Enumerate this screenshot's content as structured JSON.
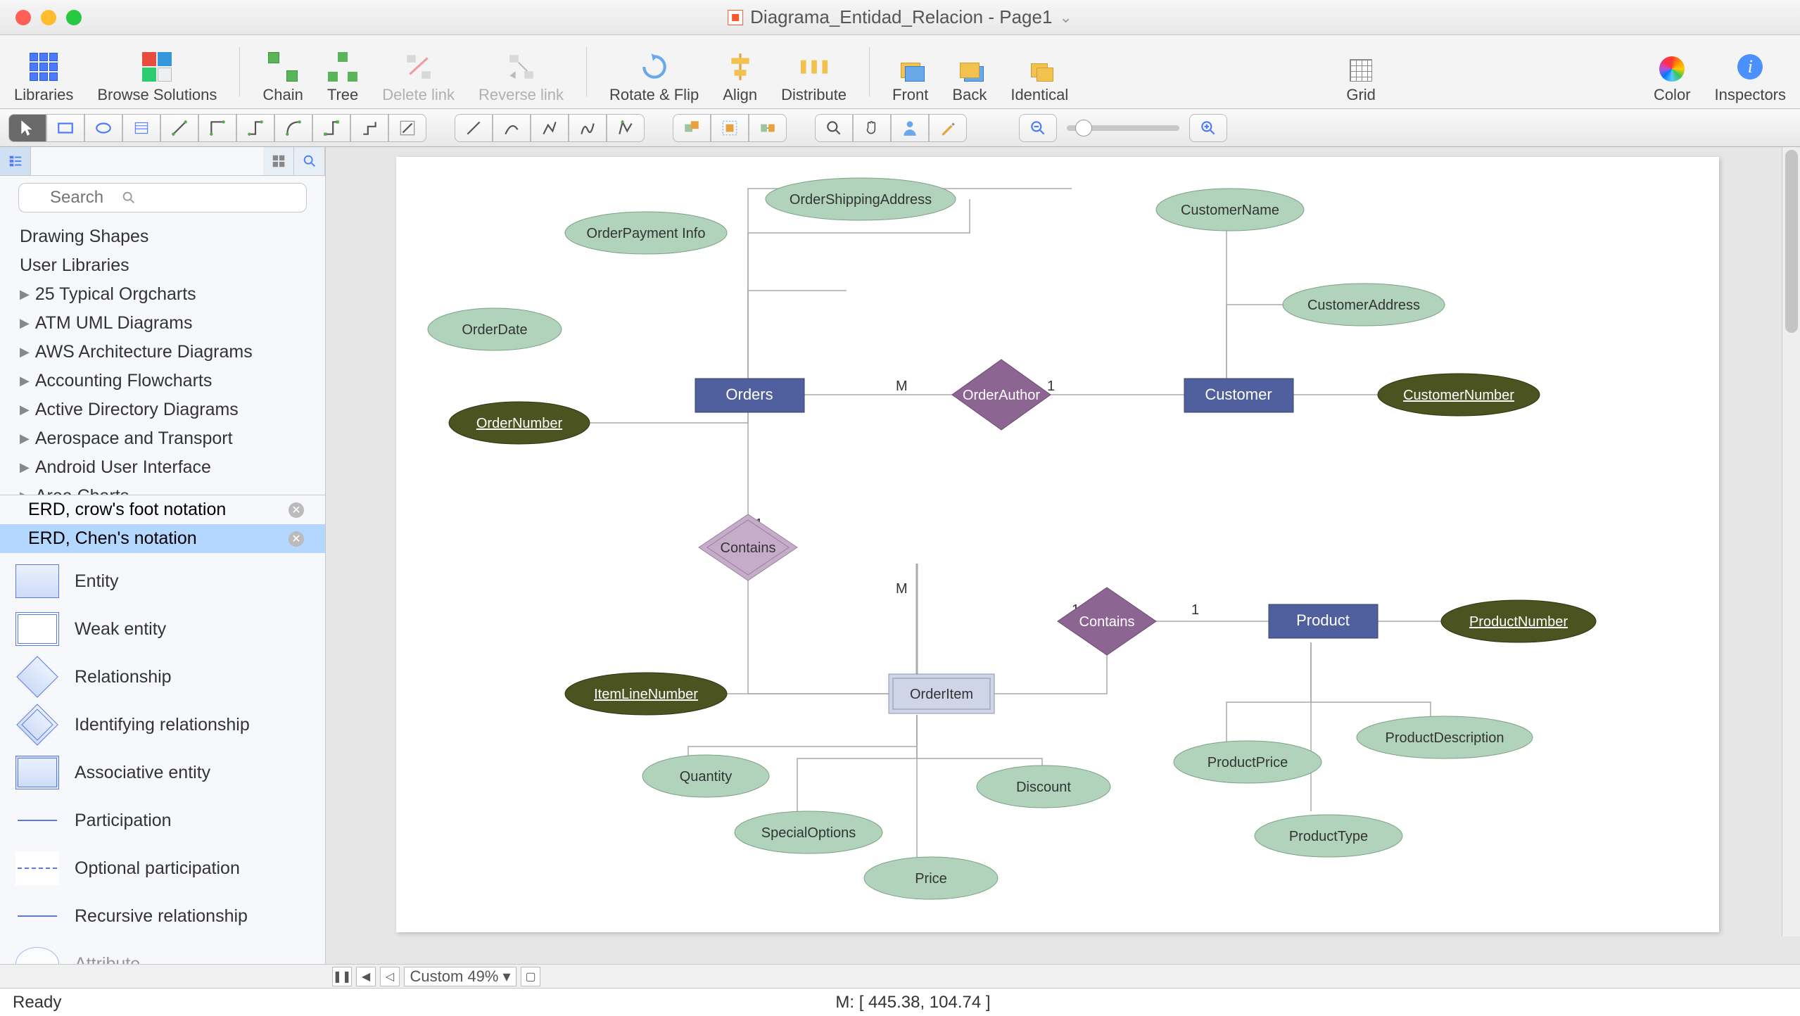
{
  "title": "Diagrama_Entidad_Relacion - Page1",
  "toolbar": {
    "libraries": "Libraries",
    "browse": "Browse Solutions",
    "chain": "Chain",
    "tree": "Tree",
    "delete": "Delete link",
    "reverse": "Reverse link",
    "rotate": "Rotate & Flip",
    "align": "Align",
    "distribute": "Distribute",
    "front": "Front",
    "back": "Back",
    "identical": "Identical",
    "grid": "Grid",
    "color": "Color",
    "inspectors": "Inspectors"
  },
  "sidebar": {
    "search_placeholder": "Search",
    "groups": [
      "Drawing Shapes",
      "User Libraries",
      "25 Typical Orgcharts",
      "ATM UML Diagrams",
      "AWS Architecture Diagrams",
      "Accounting Flowcharts",
      "Active Directory Diagrams",
      "Aerospace and Transport",
      "Android User Interface",
      "Area Charts"
    ],
    "stencil_tabs": [
      "ERD, crow's foot notation",
      "ERD, Chen's notation"
    ],
    "shapes": [
      "Entity",
      "Weak entity",
      "Relationship",
      "Identifying relationship",
      "Associative entity",
      "Participation",
      "Optional participation",
      "Recursive relationship",
      "Attribute"
    ]
  },
  "erd": {
    "entities": {
      "orders": "Orders",
      "customer": "Customer",
      "orderitem": "OrderItem",
      "product": "Product"
    },
    "relationships": {
      "orderauthor": "OrderAuthor",
      "contains1": "Contains",
      "contains2": "Contains"
    },
    "attributes": {
      "orderdate": "OrderDate",
      "orderpayment": "OrderPayment Info",
      "ordership": "OrderShippingAddress",
      "ordernum": "OrderNumber",
      "custname": "CustomerName",
      "custaddr": "CustomerAddress",
      "custnum": "CustomerNumber",
      "itemline": "ItemLineNumber",
      "quantity": "Quantity",
      "specialopt": "SpecialOptions",
      "price": "Price",
      "discount": "Discount",
      "prodnum": "ProductNumber",
      "prodprice": "ProductPrice",
      "proddesc": "ProductDescription",
      "prodtype": "ProductType"
    },
    "card": {
      "M": "M",
      "one": "1"
    }
  },
  "zoom_label": "Custom 49%",
  "status": {
    "ready": "Ready",
    "coords": "M: [ 445.38, 104.74 ]"
  }
}
